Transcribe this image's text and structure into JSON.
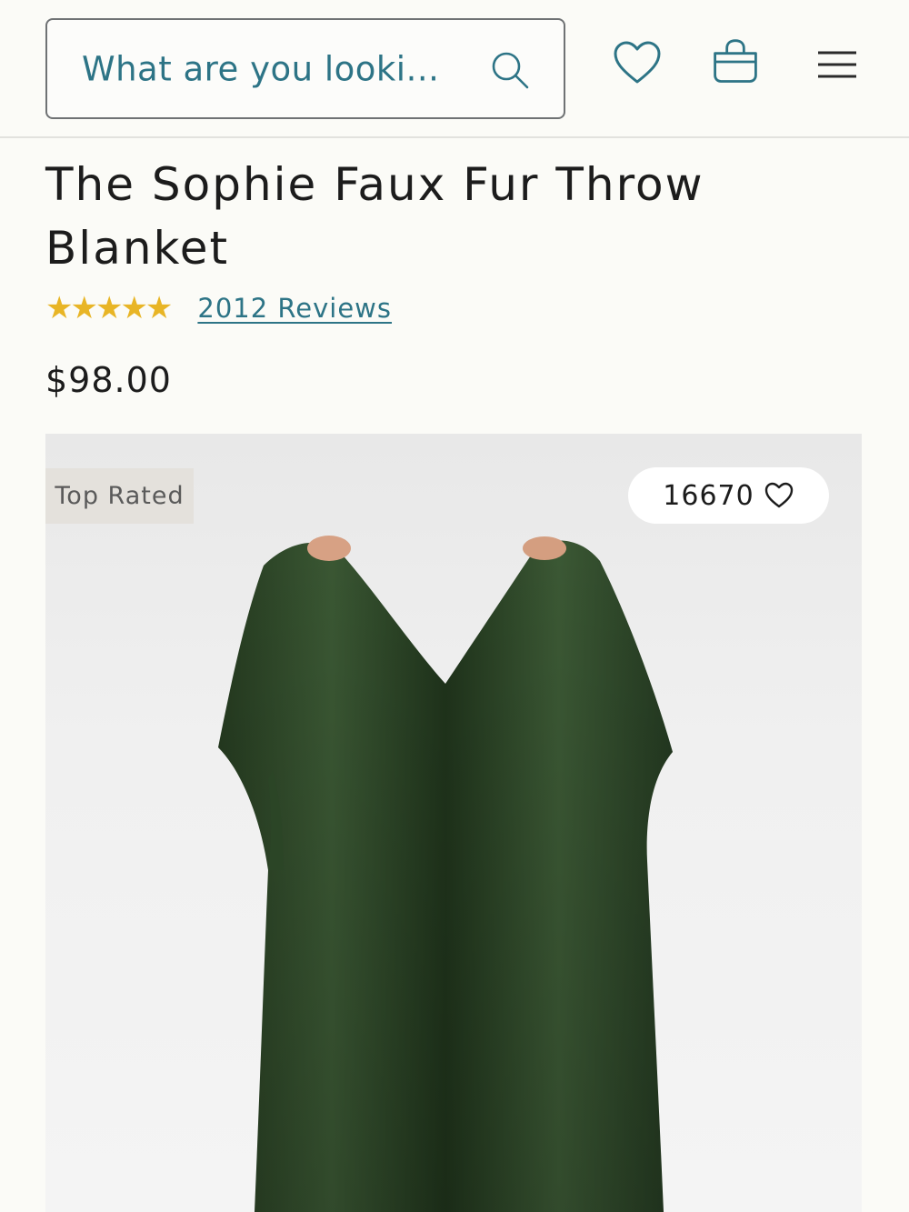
{
  "header": {
    "search": {
      "placeholder": "What are you looki..."
    },
    "icons": [
      "search-icon",
      "heart-icon",
      "shopping-bag-icon",
      "hamburger-menu-icon"
    ]
  },
  "product": {
    "title": "The Sophie Faux Fur Throw Blanket",
    "rating": 5,
    "stars_text": "★★★★★",
    "reviews_label": "2012 Reviews",
    "price": "$98.00",
    "image": {
      "badge": "Top Rated",
      "likes_count": "16670",
      "description_color": "#2f4a2a"
    }
  },
  "colors": {
    "accent": "#2d7486",
    "star": "#e8b526",
    "background": "#fbfbf7"
  }
}
